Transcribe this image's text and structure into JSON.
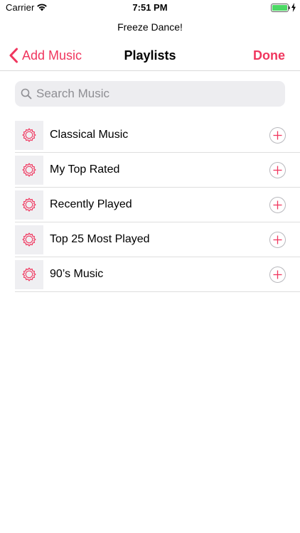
{
  "status_bar": {
    "carrier": "Carrier",
    "time": "7:51 PM",
    "battery_fill": 1.0,
    "battery_color": "#4cd964"
  },
  "subtitle": "Freeze Dance!",
  "nav": {
    "back_label": "Add Music",
    "title": "Playlists",
    "done_label": "Done",
    "accent_color": "#f0365e"
  },
  "search": {
    "placeholder": "Search Music",
    "value": ""
  },
  "playlists": [
    {
      "name": "Classical Music",
      "icon": "playlist-gear-icon",
      "action_icon": "add-icon"
    },
    {
      "name": "My Top Rated",
      "icon": "playlist-gear-icon",
      "action_icon": "add-icon"
    },
    {
      "name": "Recently Played",
      "icon": "playlist-gear-icon",
      "action_icon": "add-icon"
    },
    {
      "name": "Top 25 Most Played",
      "icon": "playlist-gear-icon",
      "action_icon": "add-icon"
    },
    {
      "name": "90’s Music",
      "icon": "playlist-gear-icon",
      "action_icon": "add-icon"
    }
  ]
}
